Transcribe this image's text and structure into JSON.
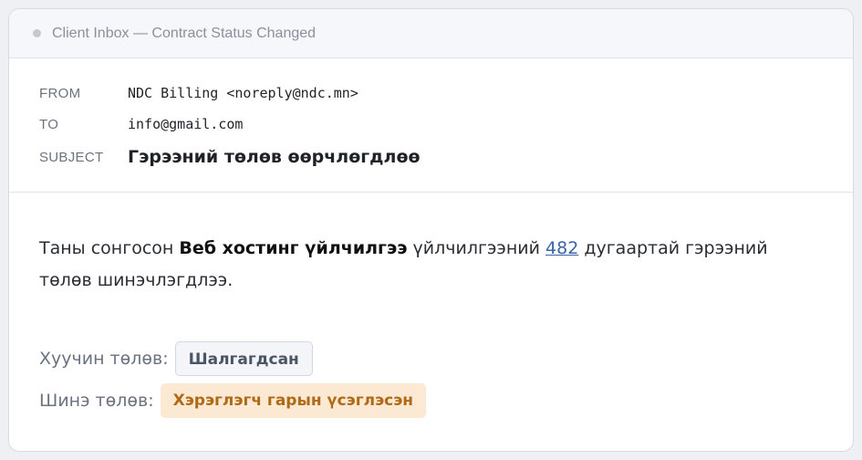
{
  "window": {
    "title": "Client Inbox — Contract Status Changed"
  },
  "email": {
    "from_label": "FROM",
    "from_value": "NDC Billing <noreply@ndc.mn>",
    "to_label": "TO",
    "to_value": "info@gmail.com",
    "subject_label": "SUBJECT",
    "subject_value": "Гэрээний төлөв өөрчлөгдлөө"
  },
  "message": {
    "part1": "Таны сонгосон ",
    "service_name": "Веб хостинг үйлчилгээ",
    "part2": " үйлчилгээний ",
    "contract_number": "482",
    "part3": " дугаартай гэрээний төлөв шинэчлэгдлээ."
  },
  "status": {
    "old_label": "Хуучин төлөв:",
    "old_value": "Шалгагдсан",
    "new_label": "Шинэ төлөв:",
    "new_value": "Хэрэглэгч гарын үсэглэсэн"
  },
  "colors": {
    "old_badge_bg": "#f3f5f8",
    "new_badge_bg": "#fbe9d3",
    "new_badge_text": "#b06a17",
    "link": "#3b63a8"
  }
}
